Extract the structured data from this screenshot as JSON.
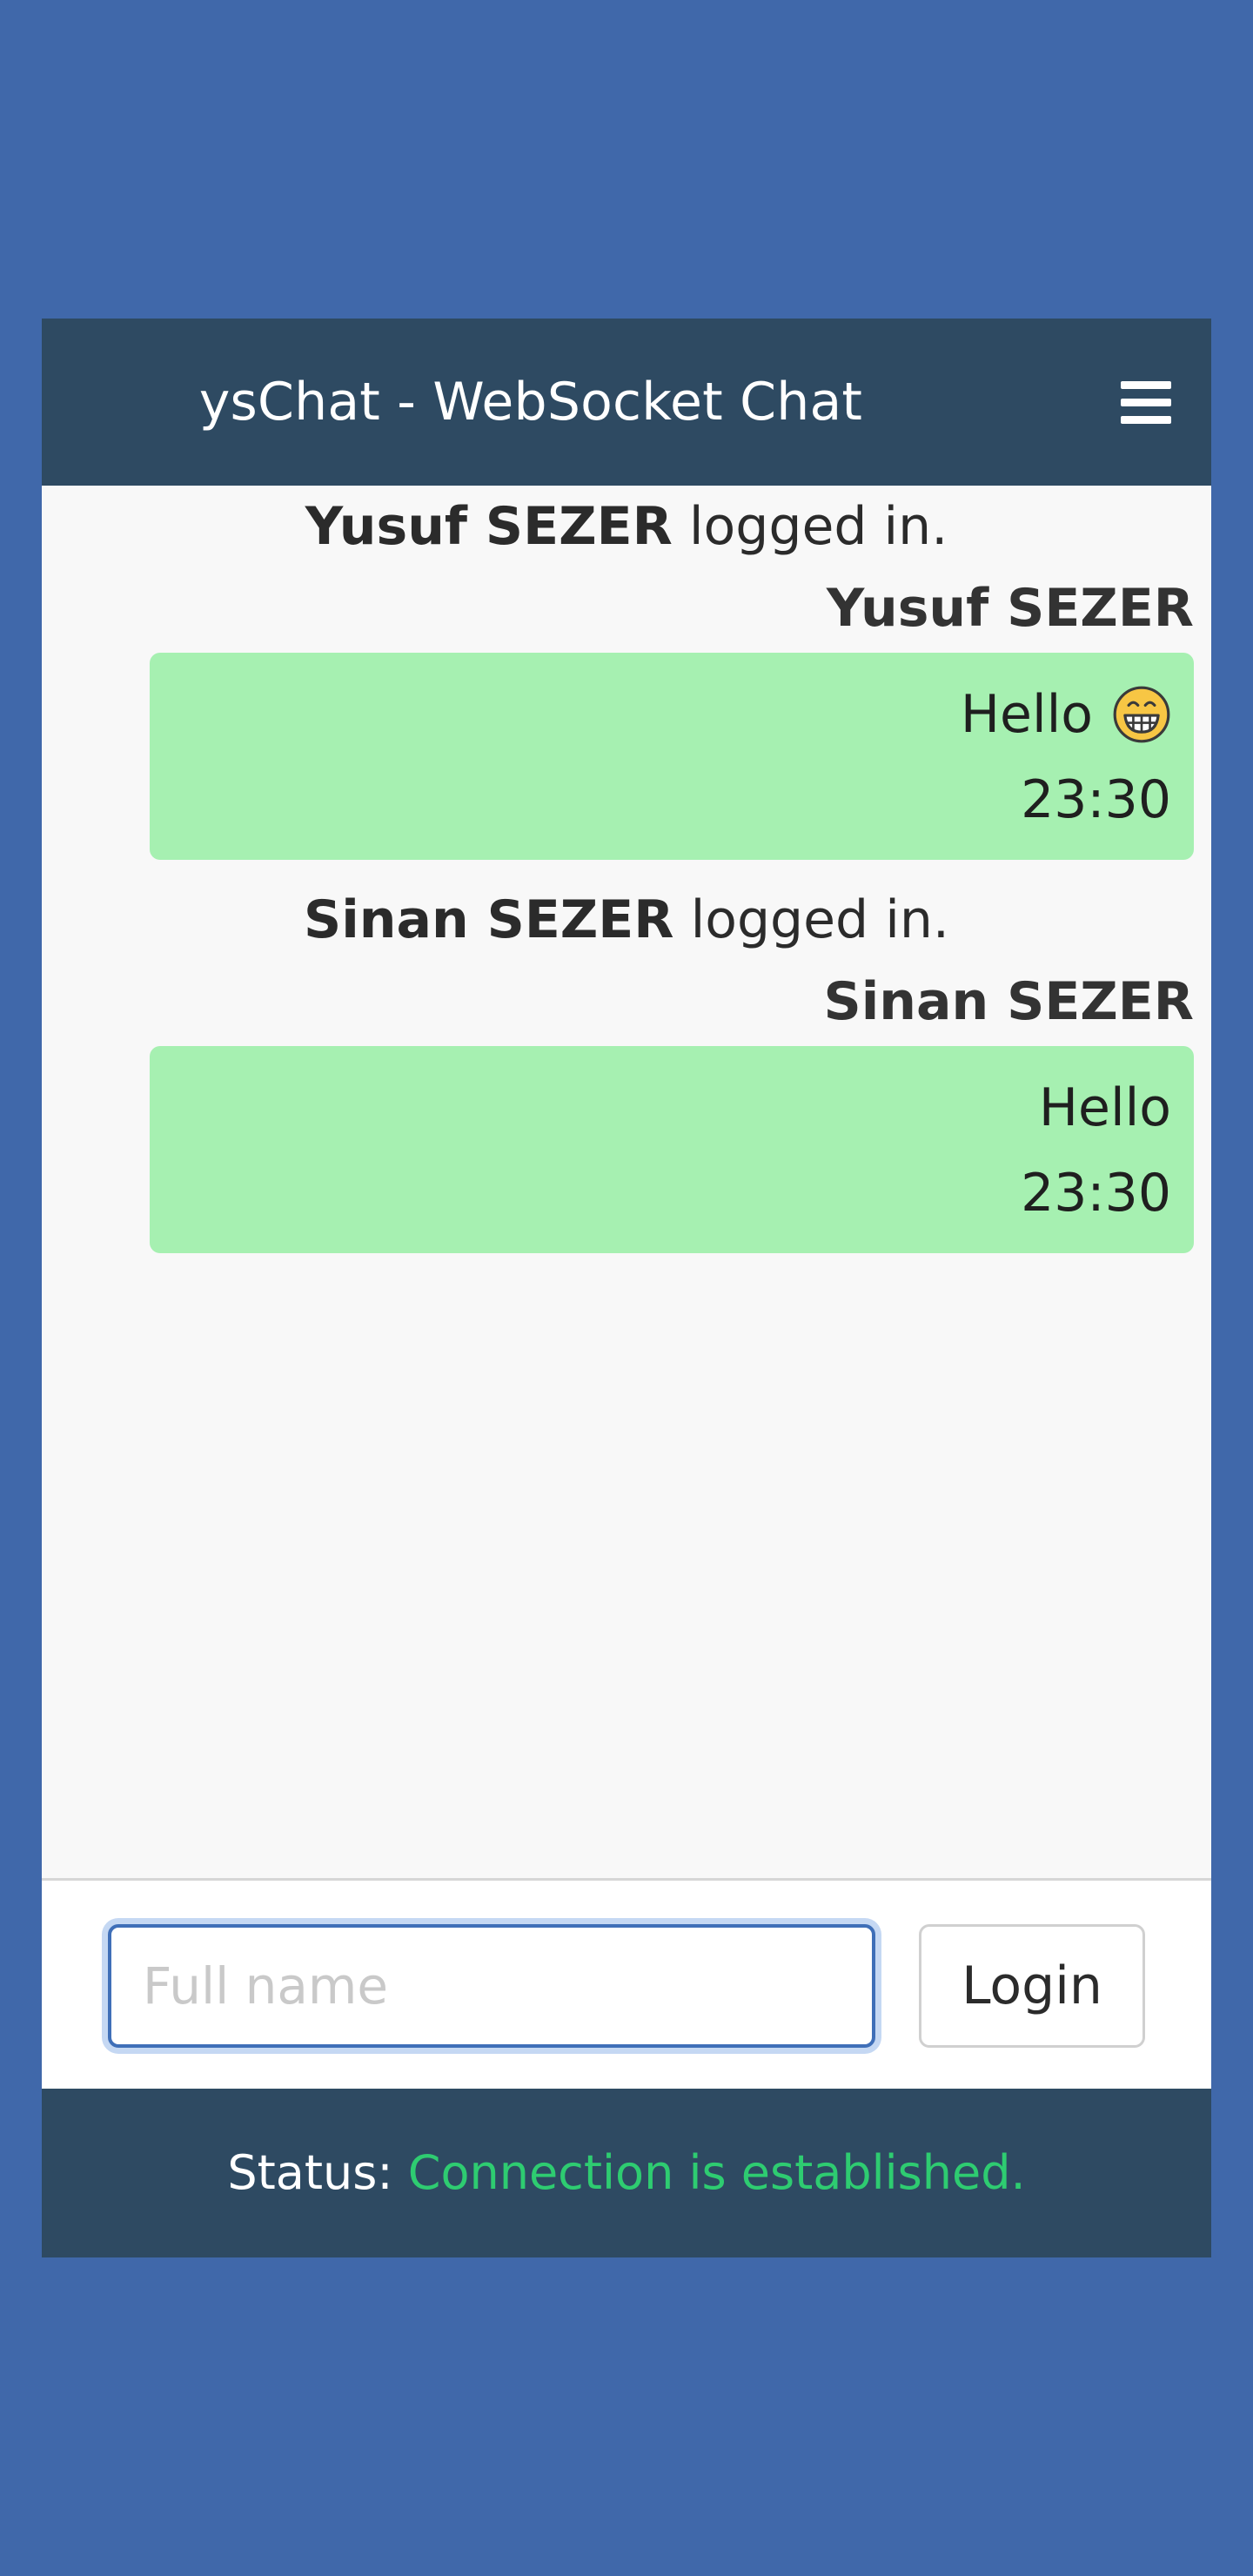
{
  "header": {
    "title": "ysChat - WebSocket Chat",
    "menu_icon": "hamburger-menu-icon"
  },
  "messages": [
    {
      "type": "system",
      "user": "Yusuf SEZER",
      "text": "logged in."
    },
    {
      "type": "chat",
      "sender": "Yusuf SEZER",
      "text": "Hello",
      "emoji": "grinning-face",
      "time": "23:30"
    },
    {
      "type": "system",
      "user": "Sinan SEZER",
      "text": "logged in."
    },
    {
      "type": "chat",
      "sender": "Sinan SEZER",
      "text": "Hello",
      "time": "23:30"
    }
  ],
  "login": {
    "placeholder": "Full name",
    "value": "",
    "button_label": "Login"
  },
  "footer": {
    "status_label": "Status:",
    "status_value": "Connection is established.",
    "status_color": "#2ecc71"
  },
  "colors": {
    "page_background": "#4068aa",
    "header_background": "#2e4a62",
    "bubble_background": "#a6f0b1"
  }
}
